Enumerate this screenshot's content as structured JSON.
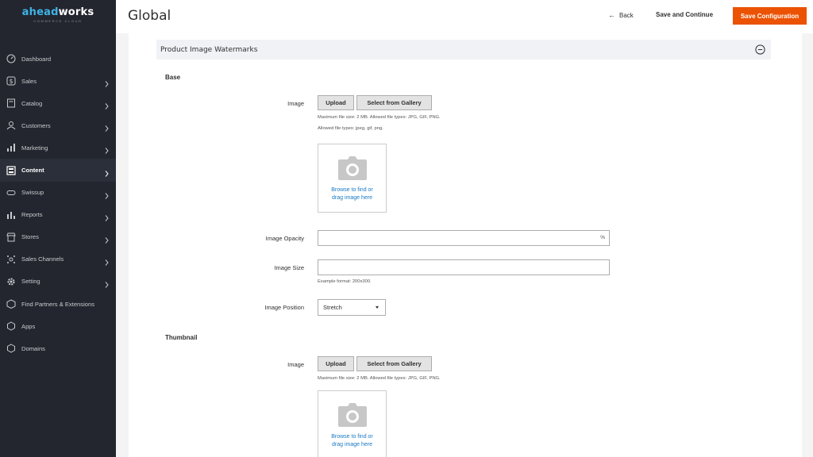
{
  "sidebar": {
    "logo": {
      "main_a": "ahead",
      "main_b": "works",
      "sub": "COMMERCE CLOUD"
    },
    "items": [
      {
        "label": "Dashboard",
        "icon": "dashboard-icon",
        "chevron": false,
        "active": false
      },
      {
        "label": "Sales",
        "icon": "dollar-icon",
        "chevron": true,
        "active": false
      },
      {
        "label": "Catalog",
        "icon": "catalog-icon",
        "chevron": true,
        "active": false
      },
      {
        "label": "Customers",
        "icon": "customers-icon",
        "chevron": true,
        "active": false
      },
      {
        "label": "Marketing",
        "icon": "marketing-icon",
        "chevron": true,
        "active": false
      },
      {
        "label": "Content",
        "icon": "content-icon",
        "chevron": true,
        "active": true
      },
      {
        "label": "Swissup",
        "icon": "swissup-icon",
        "chevron": true,
        "active": false
      },
      {
        "label": "Reports",
        "icon": "reports-icon",
        "chevron": true,
        "active": false
      },
      {
        "label": "Stores",
        "icon": "stores-icon",
        "chevron": true,
        "active": false
      },
      {
        "label": "Sales Channels",
        "icon": "sales-channels-icon",
        "chevron": true,
        "active": false
      },
      {
        "label": "Setting",
        "icon": "gear-icon",
        "chevron": true,
        "active": false
      },
      {
        "label": "Find Partners & Extensions",
        "icon": "extensions-icon",
        "chevron": false,
        "active": false
      },
      {
        "label": "Apps",
        "icon": "apps-icon",
        "chevron": false,
        "active": false
      },
      {
        "label": "Domains",
        "icon": "domains-icon",
        "chevron": false,
        "active": false
      }
    ]
  },
  "header": {
    "title": "Global",
    "back_label": "Back",
    "save_continue_label": "Save and Continue",
    "save_config_label": "Save Configuration"
  },
  "section": {
    "title": "Product Image Watermarks",
    "base": {
      "heading": "Base",
      "image_label": "Image",
      "upload_label": "Upload",
      "gallery_label": "Select from Gallery",
      "note_size": "Maximum file size: 2 MB. Allowed file types: JPG, GIF, PNG.",
      "note_types": "Allowed file types: jpeg, gif, png.",
      "dropzone_line1": "Browse to find or",
      "dropzone_line2": "drag image here",
      "opacity_label": "Image Opacity",
      "opacity_value": "",
      "opacity_suffix": "%",
      "size_label": "Image Size",
      "size_value": "",
      "size_note": "Example format: 200x300.",
      "position_label": "Image Position",
      "position_value": "Stretch"
    },
    "thumbnail": {
      "heading": "Thumbnail",
      "image_label": "Image",
      "upload_label": "Upload",
      "gallery_label": "Select from Gallery",
      "note_size": "Maximum file size: 2 MB. Allowed file types: JPG, GIF, PNG.",
      "dropzone_line1": "Browse to find or",
      "dropzone_line2": "drag image here"
    }
  },
  "colors": {
    "sidebar_bg": "#23262f",
    "accent_orange": "#eb5202",
    "link_blue": "#1979c3",
    "logo_blue": "#3fb3e6"
  }
}
